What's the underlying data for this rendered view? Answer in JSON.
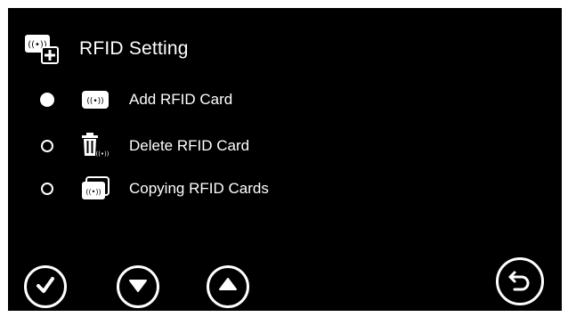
{
  "header": {
    "title": "RFID Setting",
    "icon": "rfid-card-add-icon"
  },
  "menu": {
    "items": [
      {
        "label": "Add RFID Card",
        "icon": "rfid-card-icon",
        "selected": true
      },
      {
        "label": "Delete RFID Card",
        "icon": "trash-rfid-icon",
        "selected": false
      },
      {
        "label": "Copying RFID Cards",
        "icon": "rfid-cards-copy-icon",
        "selected": false
      }
    ]
  },
  "footer": {
    "buttons": [
      {
        "name": "confirm",
        "icon": "checkmark-icon"
      },
      {
        "name": "down",
        "icon": "arrow-down-icon"
      },
      {
        "name": "up",
        "icon": "arrow-up-icon"
      },
      {
        "name": "back",
        "icon": "return-icon"
      }
    ]
  },
  "colors": {
    "background": "#000000",
    "foreground": "#ffffff",
    "frame": "#ffffff"
  }
}
